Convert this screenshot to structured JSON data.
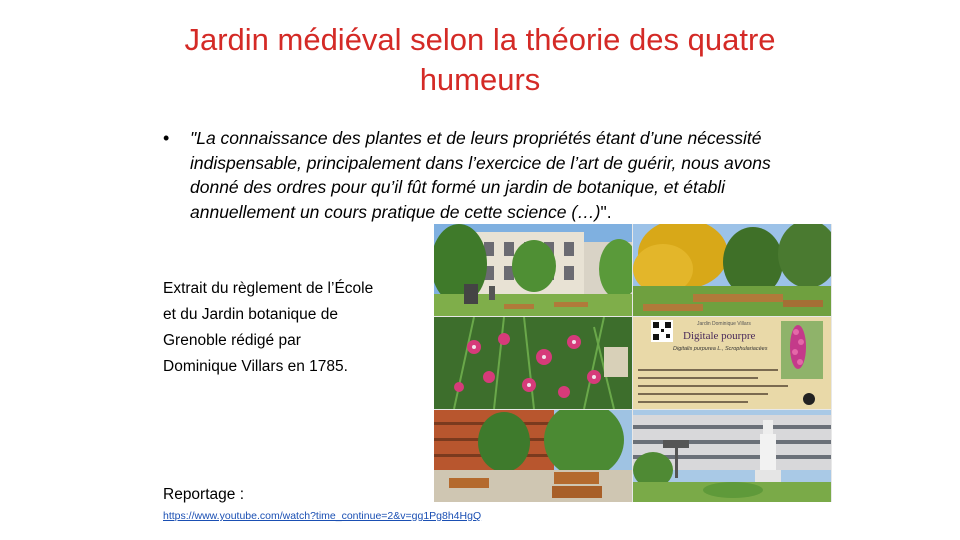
{
  "slide": {
    "title": "Jardin médiéval selon la théorie des quatre humeurs",
    "bullet_symbol": "•",
    "quote_italic": "\"La connaissance des plantes et de leurs propriétés étant d’une nécessité indispensable, principalement dans l’exercice de l’art de guérir, nous avons donné des ordres pour qu’il fût formé un jardin de botanique, et établi annuellement un cours pratique de cette science (…)",
    "quote_tail": "\".",
    "extract_lines": [
      "Extrait du règlement de l’École",
      "et du Jardin botanique de",
      "Grenoble rédigé par",
      "Dominique Villars en 1785."
    ],
    "reportage_label": "Reportage :",
    "reportage_link": "https://www.youtube.com/watch?time_continue=2&v=gg1Pg8h4HgQ"
  },
  "sign": {
    "header": "Jardin Dominique Villars",
    "name": "Digitale pourpre",
    "latin": "Digitalis purpurea L., Scrophulariacées"
  },
  "colors": {
    "title": "#d42a26",
    "link": "#1a4fb3",
    "sign_background": "#e9d9a8"
  }
}
